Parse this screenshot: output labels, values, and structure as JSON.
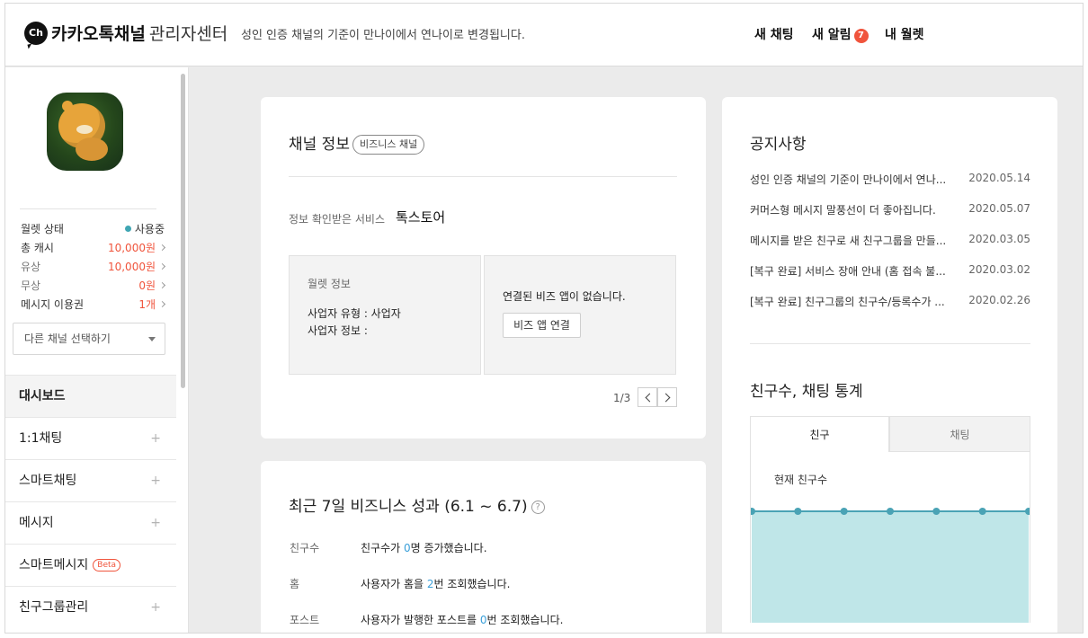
{
  "header": {
    "logo_text": "Ch",
    "brand_bold": "카카오톡채널",
    "brand_light": "관리자센터",
    "notice": "성인 인증 채널의 기준이 만나이에서 연나이로 변경됩니다.",
    "nav": {
      "new_chat": "새 채팅",
      "new_alarm": "새 알림",
      "alarm_count": "7",
      "my_wallet": "내 월렛"
    }
  },
  "sidebar": {
    "wallet": [
      {
        "label": "월렛 상태",
        "value": "사용중"
      },
      {
        "label": "총 캐시",
        "value": "10,000원"
      },
      {
        "label": "유상",
        "value": "10,000원"
      },
      {
        "label": "무상",
        "value": "0원"
      },
      {
        "label": "메시지 이용권",
        "value": "1개"
      }
    ],
    "channel_select_placeholder": "다른 채널 선택하기",
    "menu": [
      {
        "label": "대시보드"
      },
      {
        "label": "1:1채팅"
      },
      {
        "label": "스마트채팅"
      },
      {
        "label": "메시지"
      },
      {
        "label": "스마트메시지",
        "badge": "Beta"
      },
      {
        "label": "친구그룹관리"
      }
    ],
    "plus_symbol": "+"
  },
  "channel_info": {
    "title": "채널 정보",
    "tag": "비즈니스 채널",
    "service_label": "정보 확인받은 서비스",
    "service_value": "톡스토어",
    "wallet_box": {
      "title": "월렛 정보",
      "line1": "사업자 유형 : 사업자",
      "line2": "사업자 정보 :"
    },
    "biz_app": {
      "message": "연결된 비즈 앱이 없습니다.",
      "button": "비즈 앱 연결"
    },
    "pager": "1/3"
  },
  "performance": {
    "title": "최근 7일 비즈니스 성과 (6.1 ~ 6.7)",
    "help": "?",
    "rows": [
      {
        "key": "친구수",
        "before": "친구수가 ",
        "num": "0",
        "after": "명 증가했습니다."
      },
      {
        "key": "홈",
        "before": "사용자가 홈을 ",
        "num": "2",
        "after": "번 조회했습니다."
      },
      {
        "key": "포스트",
        "before": "사용자가 발행한 포스트를 ",
        "num": "0",
        "after": "번 조회했습니다."
      }
    ]
  },
  "notices": {
    "title": "공지사항",
    "items": [
      {
        "text": "성인 인증 채널의 기준이 만나이에서 연나...",
        "date": "2020.05.14"
      },
      {
        "text": "커머스형 메시지 말풍선이 더 좋아집니다.",
        "date": "2020.05.07"
      },
      {
        "text": "메시지를 받은 친구로 새 친구그룹을 만들...",
        "date": "2020.03.05"
      },
      {
        "text": "[복구 완료] 서비스 장애 안내 (홈 접속 불...",
        "date": "2020.03.02"
      },
      {
        "text": "[복구 완료] 친구그룹의 친구수/등록수가 ...",
        "date": "2020.02.26"
      }
    ]
  },
  "stats": {
    "title": "친구수, 채팅 통계",
    "tabs": [
      "친구",
      "채팅"
    ],
    "label": "현재 친구수",
    "colors": {
      "line": "#4aa3b5",
      "fill": "#bfe6e8"
    }
  },
  "chart_data": {
    "type": "area",
    "x": [
      "",
      "",
      "",
      "",
      "",
      "",
      ""
    ],
    "values": [
      0,
      0,
      0,
      0,
      0,
      0,
      0
    ],
    "title": "",
    "xlabel": "",
    "ylabel": "",
    "grid": false
  }
}
